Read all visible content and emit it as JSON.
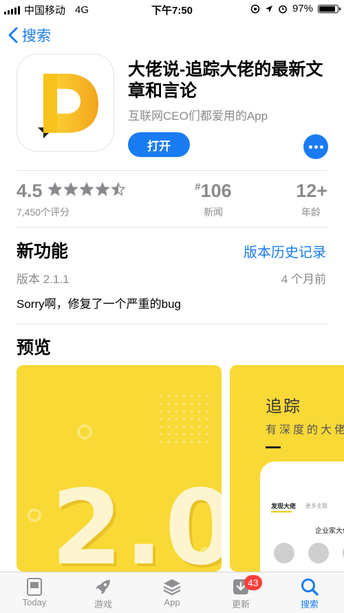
{
  "status_bar": {
    "carrier": "中国移动",
    "network": "4G",
    "time": "下午7:50",
    "battery": "97%",
    "battery_level": 0.97
  },
  "nav": {
    "back_label": "搜索"
  },
  "app": {
    "title": "大佬说-追踪大佬的最新文章和言论",
    "subtitle": "互联网CEO们都爱用的App",
    "open_label": "打开",
    "icon_name": "app-logo-d"
  },
  "stats": {
    "rating": "4.5",
    "rating_stars": 4.5,
    "rating_count": "7,450个评分",
    "rank_prefix": "#",
    "rank": "106",
    "rank_label": "新闻",
    "age": "12+",
    "age_label": "年龄"
  },
  "whats_new": {
    "title": "新功能",
    "history_link": "版本历史记录",
    "version": "版本 2.1.1",
    "time_ago": "4 个月前",
    "notes": "Sorry啊，修复了一个严重的bug"
  },
  "preview": {
    "title": "预览",
    "shot1_text": "2.0",
    "shot2_heading": "追踪",
    "shot2_sub": "有深度的大佬",
    "shot2_tab_active": "发现大佬",
    "shot2_tab_other": "更多主题",
    "shot2_section": "企业家大佬"
  },
  "tabbar": {
    "items": [
      {
        "label": "Today",
        "icon": "today-icon"
      },
      {
        "label": "游戏",
        "icon": "rocket-icon"
      },
      {
        "label": "App",
        "icon": "layers-icon"
      },
      {
        "label": "更新",
        "icon": "download-icon",
        "badge": "43"
      },
      {
        "label": "搜索",
        "icon": "search-icon",
        "active": true
      }
    ]
  },
  "colors": {
    "accent": "#1a7cf3",
    "icon_yellow": "#f7c21b",
    "preview_yellow": "#f9d936",
    "badge_red": "#fc3d39"
  }
}
